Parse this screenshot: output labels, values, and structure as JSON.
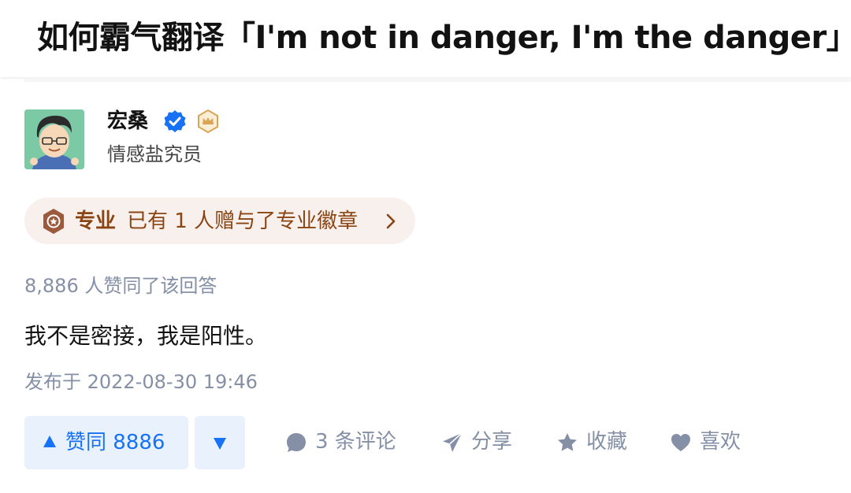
{
  "question": {
    "title": "如何霸气翻译「I'm not in danger, I'm the danger」？"
  },
  "author": {
    "name": "宏桑",
    "headline": "情感盐究员",
    "avatar": "avatar-image",
    "verified_icon": "verified-check-icon",
    "badge_icon": "crown-badge-icon"
  },
  "pro_badge": {
    "icon": "medal-icon",
    "label": "专业",
    "text": "已有 1 人赠与了专业徽章"
  },
  "answer": {
    "votes_info": "8,886 人赞同了该回答",
    "content": "我不是密接，我是阳性。",
    "publish_time": "发布于 2022-08-30 19:46"
  },
  "actions": {
    "upvote_label": "赞同 8886",
    "comments_label": "3 条评论",
    "share_label": "分享",
    "favorite_label": "收藏",
    "like_label": "喜欢"
  },
  "colors": {
    "accent": "#1772f6",
    "accent_bg": "#e9f1fd",
    "muted": "#8590a6",
    "badge_text": "#8b4513",
    "badge_bg": "#f8f0ed"
  }
}
